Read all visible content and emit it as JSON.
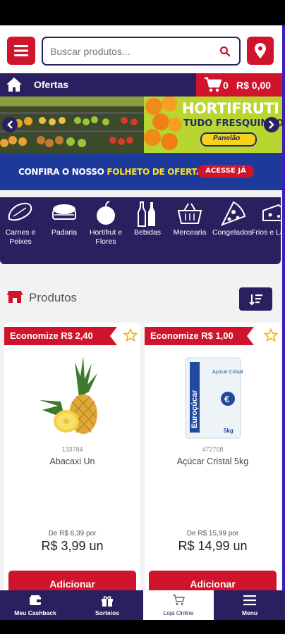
{
  "header": {
    "search_placeholder": "Buscar produtos..."
  },
  "nav": {
    "ofertas_label": "Ofertas",
    "cart_count": "0",
    "cart_total": "R$ 0,00"
  },
  "banner": {
    "title": "HORTIFRUTI",
    "subtitle": "TUDO FRESQUINHO",
    "brand": "Panelão"
  },
  "folheto": {
    "text_part1": "CONFIRA O NOSSO ",
    "text_part2": "FOLHETO DE OFERTAS",
    "button": "ACESSE JÁ"
  },
  "categories": [
    {
      "label": "Carnes e Peixes",
      "icon": "meat-icon"
    },
    {
      "label": "Padaria",
      "icon": "bread-icon"
    },
    {
      "label": "Hortifrut e Flores",
      "icon": "apple-icon"
    },
    {
      "label": "Bebidas",
      "icon": "bottles-icon"
    },
    {
      "label": "Mercearia",
      "icon": "basket-icon"
    },
    {
      "label": "Congelados",
      "icon": "pizza-icon"
    },
    {
      "label": "Frios e Laticín",
      "icon": "cheese-icon"
    }
  ],
  "produtos": {
    "title": "Produtos"
  },
  "products": [
    {
      "savings": "Economize R$ 2,40",
      "code": "133784",
      "name": "Abacaxi Un",
      "old_price": "De R$ 6,39 por",
      "new_price": "R$ 3,99 un",
      "button": "Adicionar"
    },
    {
      "savings": "Economize R$ 1,00",
      "code": "472708",
      "name": "Açúcar Cristal 5kg",
      "old_price": "De R$ 15,99 por",
      "new_price": "R$ 14,99 un",
      "button": "Adicionar"
    }
  ],
  "product_packaging": {
    "brand": "Euroçúcar",
    "label": "Açúcar Cristal",
    "weight": "5kg"
  },
  "bottom_nav": [
    {
      "label": "Meu Cashback",
      "icon": "wallet-icon"
    },
    {
      "label": "Sorteios",
      "icon": "gift-icon"
    },
    {
      "label": "Loja Online",
      "icon": "cart-icon"
    },
    {
      "label": "Menu",
      "icon": "hamburger-icon"
    }
  ],
  "colors": {
    "primary_red": "#d0142c",
    "navy": "#2a2060",
    "accent_yellow": "#ffe01a"
  }
}
